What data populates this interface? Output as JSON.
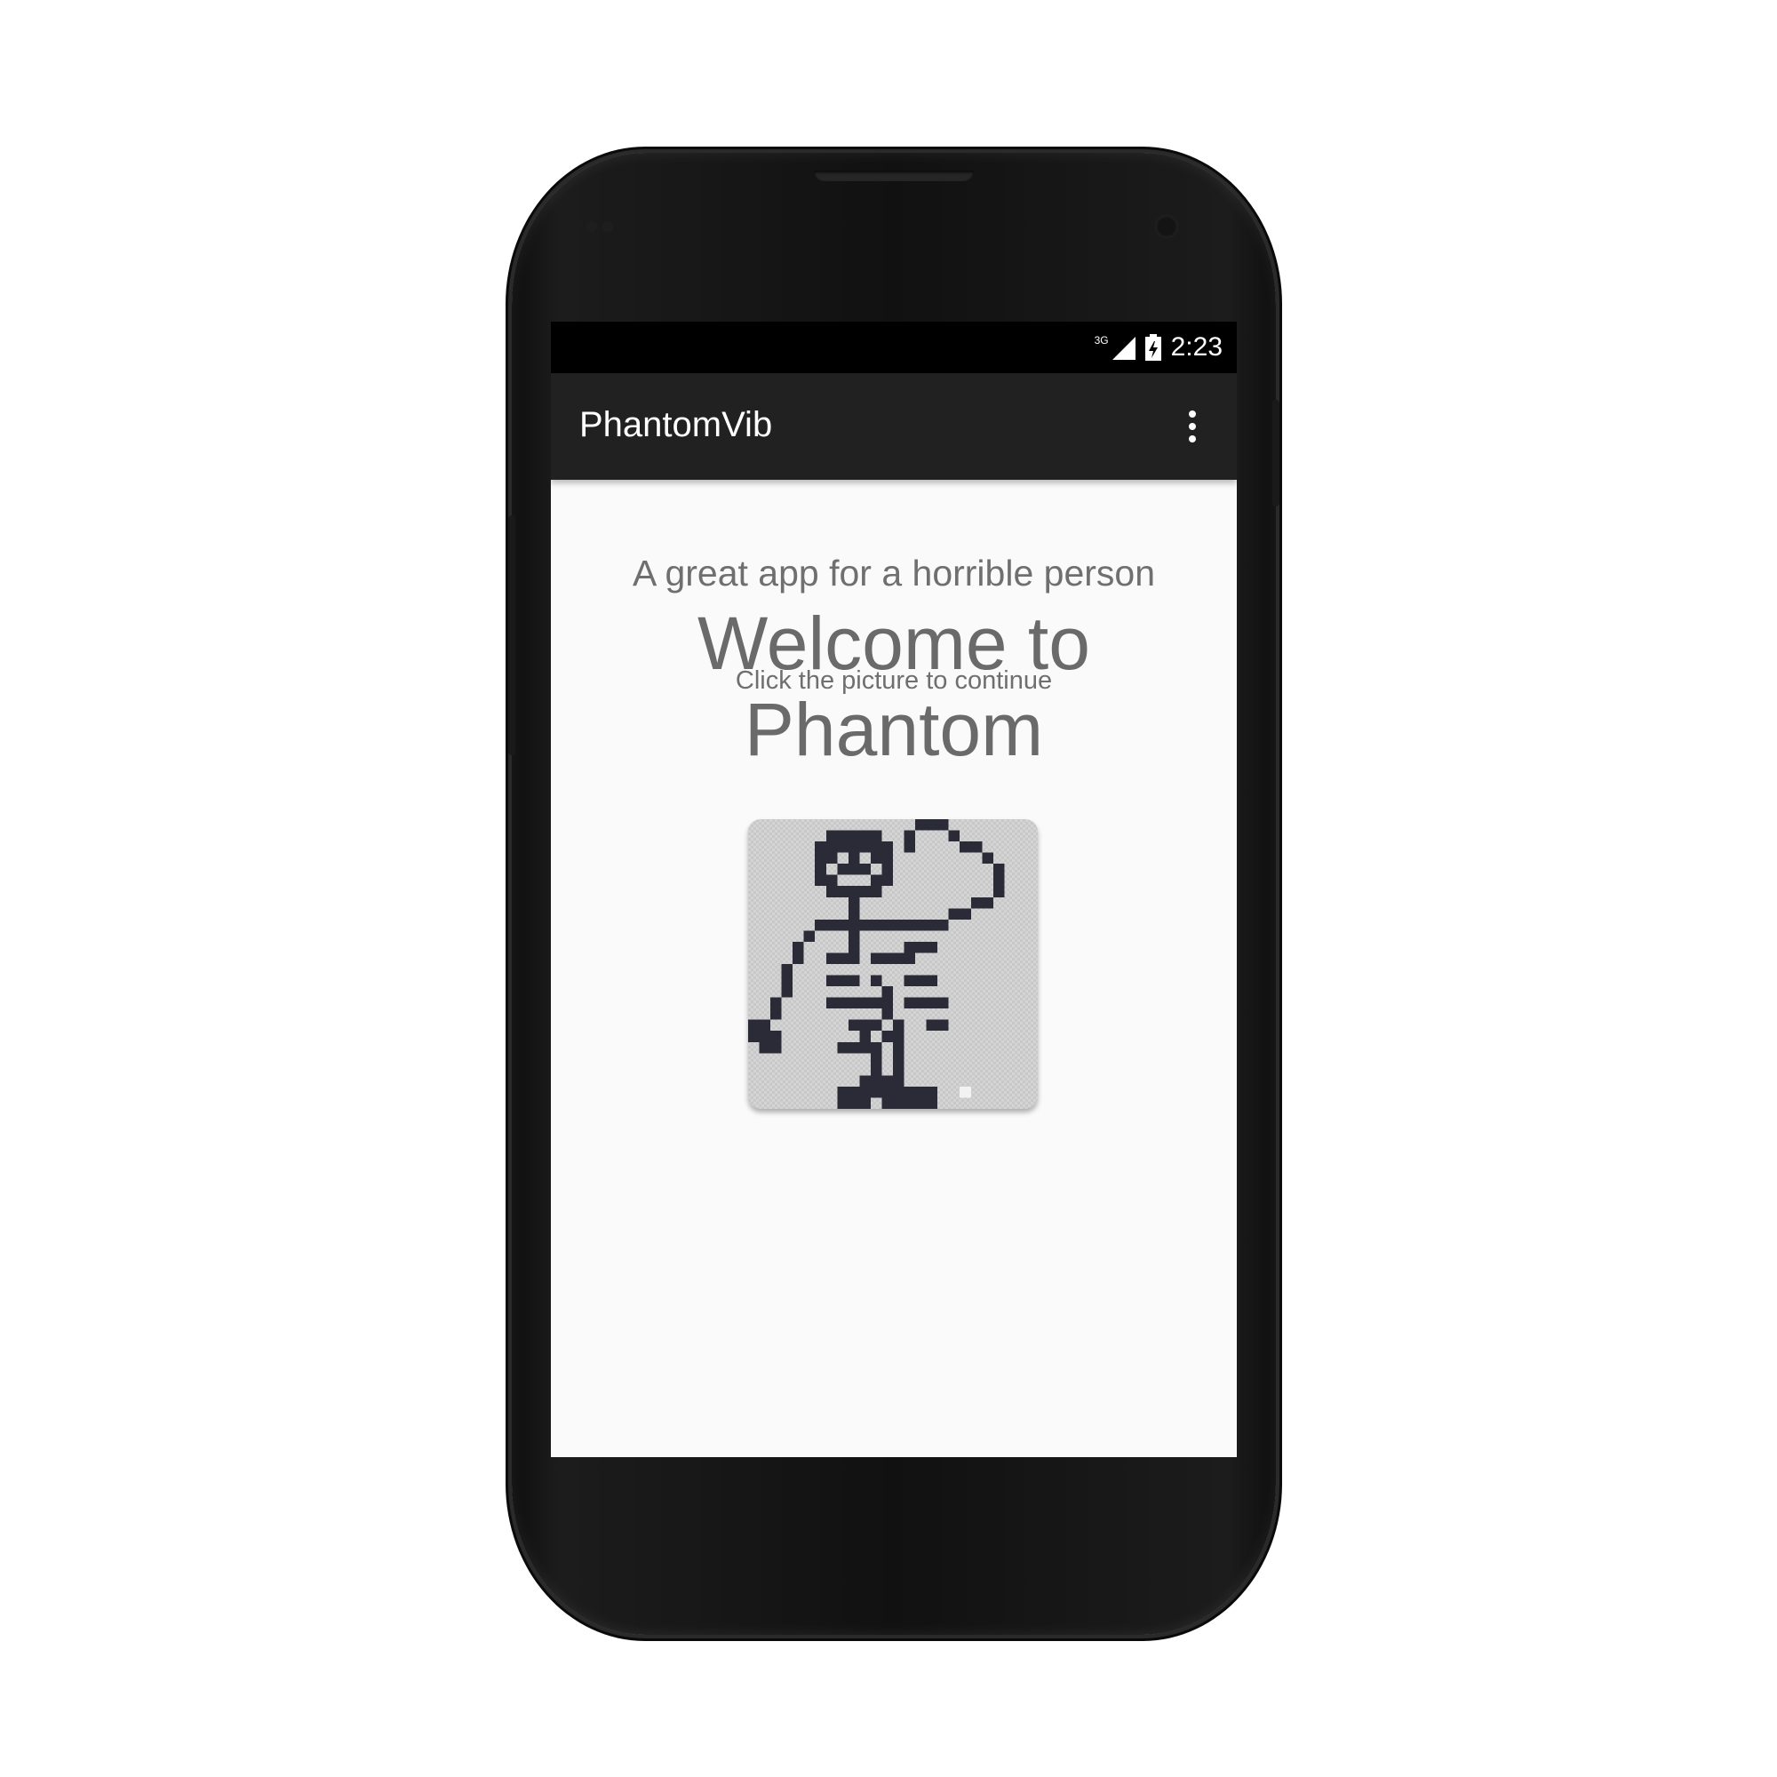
{
  "status_bar": {
    "network": "3G",
    "time": "2:23"
  },
  "app_bar": {
    "title": "PhantomVib",
    "overflow_icon": "more-vert-icon"
  },
  "content": {
    "tagline": "A great app for a horrible person",
    "welcome": "Welcome to Phantom",
    "hint": "Click the picture to continue",
    "picture_icon": "pixel-skeleton-icon"
  },
  "colors": {
    "screen_bg": "#fafafa",
    "appbar_bg": "#212121",
    "statusbar_bg": "#000000",
    "text_gray": "#6f6f6f",
    "pixel_dark": "#2b2b38"
  }
}
